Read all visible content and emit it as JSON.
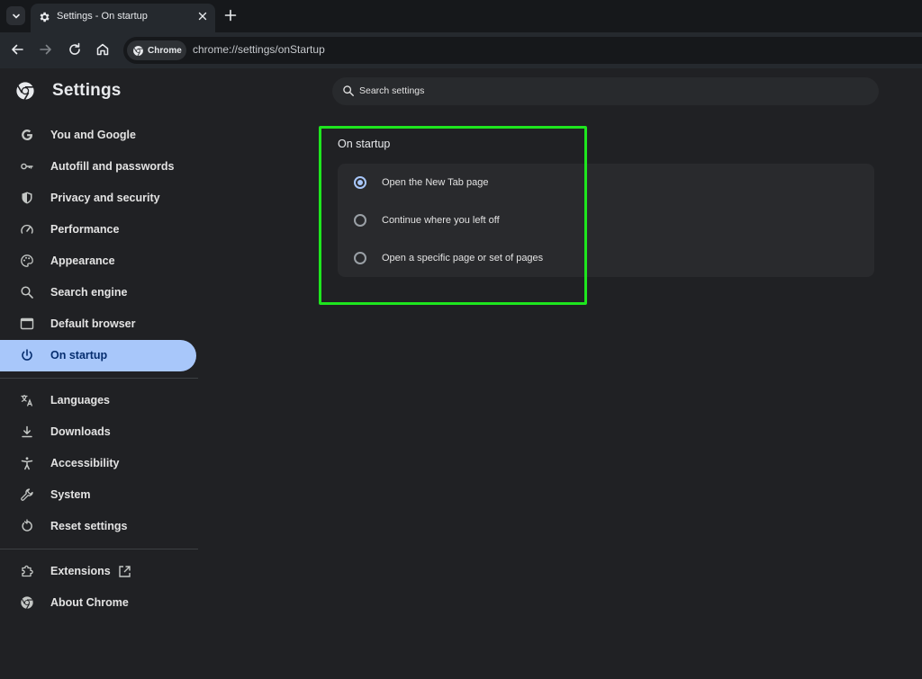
{
  "tab": {
    "title": "Settings - On startup"
  },
  "toolbar": {
    "chip_label": "Chrome",
    "url": "chrome://settings/onStartup"
  },
  "settings": {
    "title": "Settings",
    "search_placeholder": "Search settings",
    "nav": [
      {
        "label": "You and Google",
        "icon": "google-icon"
      },
      {
        "label": "Autofill and passwords",
        "icon": "key-icon"
      },
      {
        "label": "Privacy and security",
        "icon": "shield-icon"
      },
      {
        "label": "Performance",
        "icon": "speedometer-icon"
      },
      {
        "label": "Appearance",
        "icon": "palette-icon"
      },
      {
        "label": "Search engine",
        "icon": "search-icon"
      },
      {
        "label": "Default browser",
        "icon": "browser-window-icon"
      },
      {
        "label": "On startup",
        "icon": "power-icon",
        "active": true
      },
      {
        "label": "Languages",
        "icon": "translate-icon"
      },
      {
        "label": "Downloads",
        "icon": "download-icon"
      },
      {
        "label": "Accessibility",
        "icon": "accessibility-icon"
      },
      {
        "label": "System",
        "icon": "wrench-icon"
      },
      {
        "label": "Reset settings",
        "icon": "reset-icon"
      },
      {
        "label": "Extensions",
        "icon": "puzzle-icon"
      },
      {
        "label": "About Chrome",
        "icon": "chrome-icon"
      }
    ],
    "section_title": "On startup",
    "options": [
      {
        "label": "Open the New Tab page",
        "selected": true
      },
      {
        "label": "Continue where you left off",
        "selected": false
      },
      {
        "label": "Open a specific page or set of pages",
        "selected": false
      }
    ]
  },
  "colors": {
    "highlight": "#1ee51e",
    "active_nav": "#a8c7fa",
    "background": "#202124"
  }
}
